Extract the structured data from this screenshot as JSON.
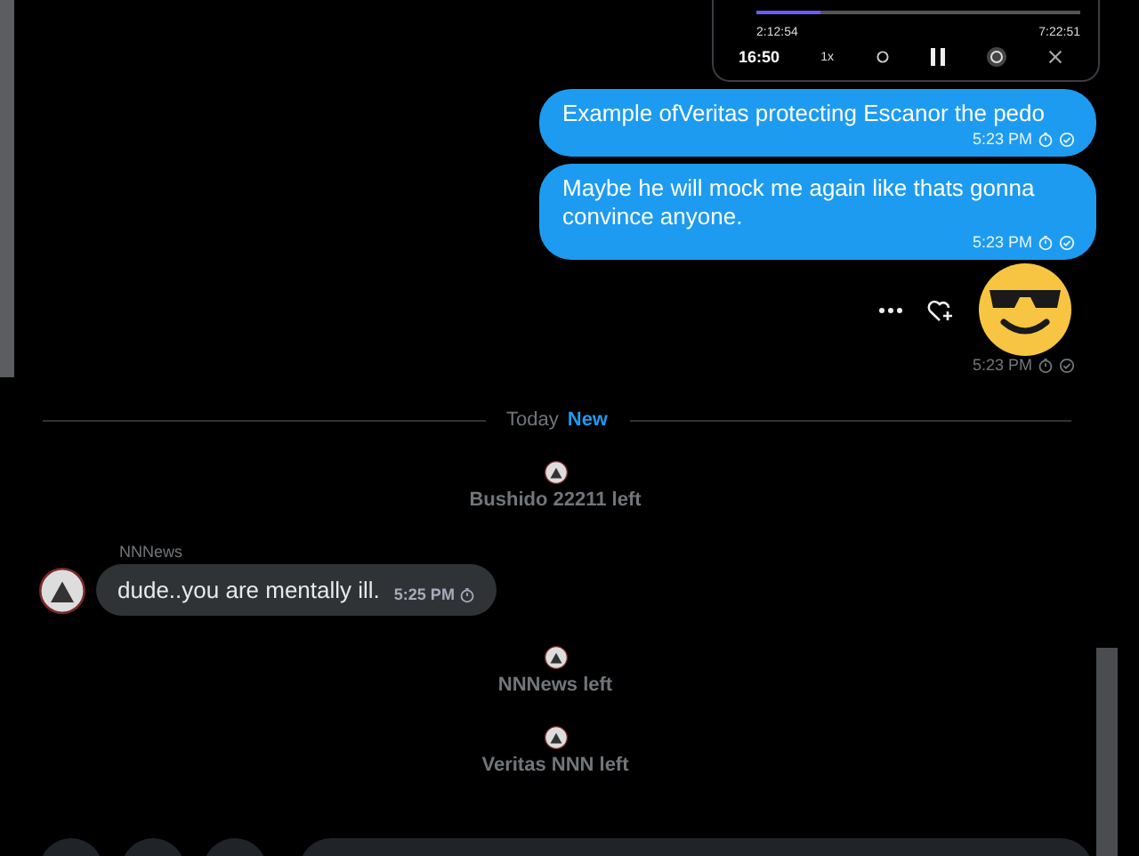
{
  "media_card": {
    "clock": "16:50",
    "elapsed": "2:12:54",
    "total": "7:22:51",
    "speed": "1x",
    "level": 0.2
  },
  "sent_messages": [
    {
      "text": "Example ofVeritas protecting Escanor the pedo",
      "time": "5:23 PM"
    },
    {
      "text": "Maybe he will mock me again like thats gonna convince anyone.",
      "time": "5:23 PM"
    }
  ],
  "emoji_message": {
    "time": "5:23 PM"
  },
  "divider": {
    "label": "Today",
    "badge": "New"
  },
  "timeline": [
    {
      "kind": "system",
      "text": "Bushido 22211 left"
    },
    {
      "kind": "incoming",
      "sender": "NNNews",
      "text": "dude..you are mentally ill.",
      "time": "5:25 PM"
    },
    {
      "kind": "system",
      "text": "NNNews left"
    },
    {
      "kind": "system",
      "text": "Veritas NNN left"
    }
  ]
}
